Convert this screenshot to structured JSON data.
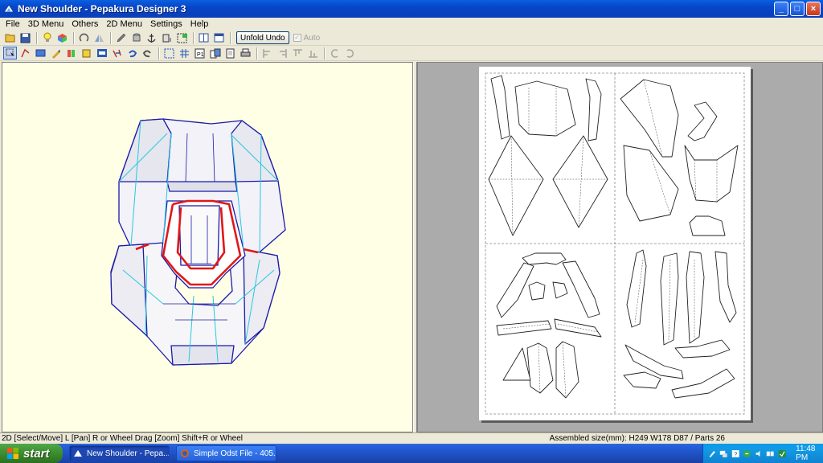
{
  "window": {
    "title": "New Shoulder - Pepakura Designer 3",
    "minimize": "_",
    "maximize": "□",
    "close": "×"
  },
  "menu": [
    "File",
    "3D Menu",
    "Others",
    "2D Menu",
    "Settings",
    "Help"
  ],
  "toolbar": {
    "unfold_undo": "Unfold Undo",
    "auto_label": "Auto",
    "auto_checked": true,
    "auto_enabled": false
  },
  "status": {
    "left": "2D [Select/Move] L [Pan] R or Wheel Drag [Zoom] Shift+R or Wheel",
    "right": "Assembled size(mm): H249 W178 D87 / Parts 26"
  },
  "taskbar": {
    "start_label": "start",
    "tasks": [
      {
        "label": "New Shoulder - Pepa...",
        "active": true
      },
      {
        "label": "Simple Odst File - 405...",
        "active": false
      }
    ],
    "clock": "11:48 PM"
  },
  "icons": {
    "tray": [
      "pen-icon",
      "network-icon",
      "help-icon",
      "safely-remove-icon",
      "volume-icon",
      "connection-icon",
      "antivirus-icon"
    ]
  },
  "colors": {
    "model_edges": "#1a1aa8",
    "highlight_edges": "#e01818",
    "fold_lines": "#28c8e0",
    "viewport_3d_bg": "#ffffe6",
    "viewport_2d_bg": "#ababab"
  }
}
